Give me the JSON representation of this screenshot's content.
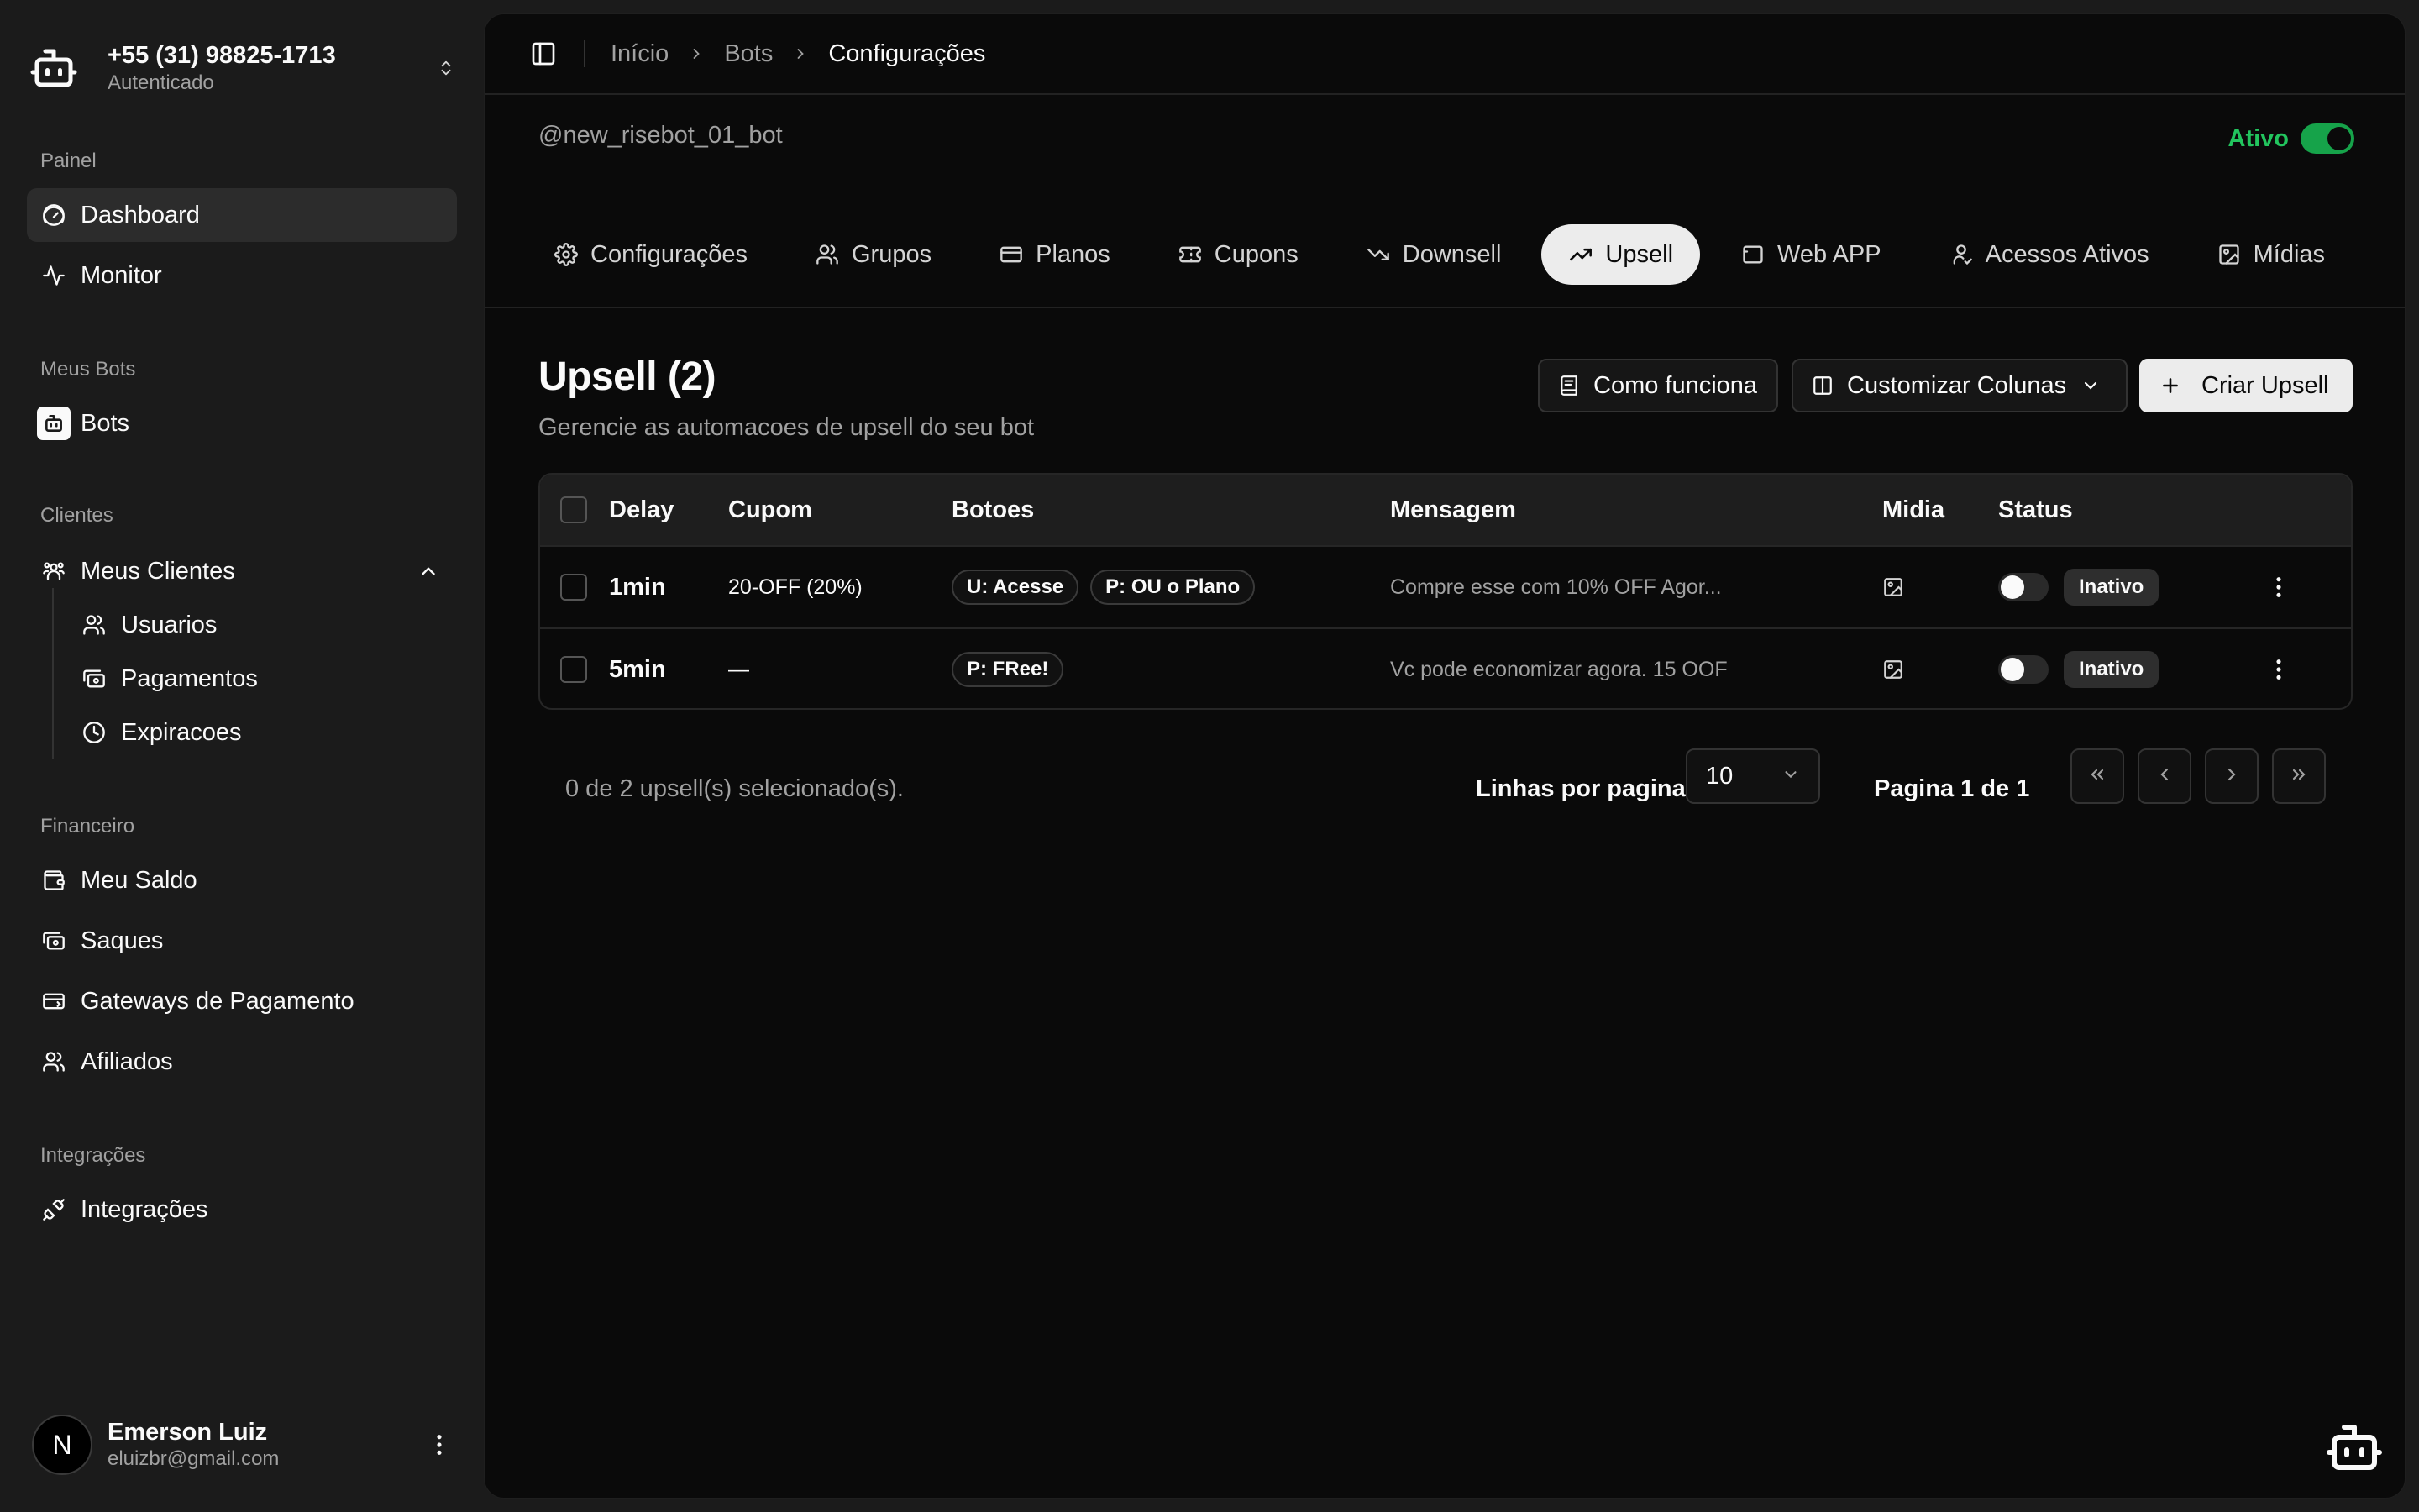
{
  "account": {
    "phone": "+55 (31) 98825-1713",
    "status": "Autenticado"
  },
  "sidebar": {
    "sections": {
      "painel": "Painel",
      "meus_bots": "Meus Bots",
      "clientes": "Clientes",
      "financeiro": "Financeiro",
      "integracoes": "Integrações"
    },
    "items": {
      "dashboard": "Dashboard",
      "monitor": "Monitor",
      "bots": "Bots",
      "meus_clientes": "Meus Clientes",
      "usuarios": "Usuarios",
      "pagamentos": "Pagamentos",
      "expiracoes": "Expiracoes",
      "meu_saldo": "Meu Saldo",
      "saques": "Saques",
      "gateways": "Gateways de Pagamento",
      "afiliados": "Afiliados",
      "integracoes": "Integrações"
    }
  },
  "user": {
    "initial": "N",
    "name": "Emerson Luiz",
    "email": "eluizbr@gmail.com"
  },
  "breadcrumb": [
    "Início",
    "Bots",
    "Configurações"
  ],
  "bot": {
    "handle": "@new_risebot_01_bot",
    "status_label": "Ativo",
    "active": true
  },
  "tabs": [
    {
      "label": "Configurações",
      "icon": "gear-icon"
    },
    {
      "label": "Grupos",
      "icon": "users-icon"
    },
    {
      "label": "Planos",
      "icon": "card-icon"
    },
    {
      "label": "Cupons",
      "icon": "ticket-icon"
    },
    {
      "label": "Downsell",
      "icon": "trend-down-icon"
    },
    {
      "label": "Upsell",
      "icon": "trend-up-icon",
      "active": true
    },
    {
      "label": "Web APP",
      "icon": "window-icon"
    },
    {
      "label": "Acessos Ativos",
      "icon": "user-check-icon"
    },
    {
      "label": "Mídias",
      "icon": "image-icon"
    }
  ],
  "page": {
    "title": "Upsell (2)",
    "subtitle": "Gerencie as automacoes de upsell do seu bot",
    "how_it_works": "Como funciona",
    "customize_columns": "Customizar Colunas",
    "create": "Criar Upsell"
  },
  "table": {
    "headers": {
      "delay": "Delay",
      "cupom": "Cupom",
      "botoes": "Botoes",
      "mensagem": "Mensagem",
      "midia": "Midia",
      "status": "Status"
    },
    "rows": [
      {
        "delay": "1min",
        "cupom": "20-OFF (20%)",
        "botoes": [
          "U: Acesse",
          "P: OU o Plano"
        ],
        "mensagem": "Compre esse com 10% OFF Agor...",
        "status": "Inativo",
        "active": false
      },
      {
        "delay": "5min",
        "cupom": "—",
        "botoes": [
          "P: FRee!"
        ],
        "mensagem": "Vc pode economizar agora. 15 OOF",
        "status": "Inativo",
        "active": false
      }
    ]
  },
  "pagination": {
    "selected": "0 de 2 upsell(s) selecionado(s).",
    "rows_label": "Linhas por pagina",
    "rows_value": "10",
    "page_label": "Pagina 1 de 1"
  },
  "colors": {
    "accent_green": "#22c55e",
    "panel_bg": "#0a0a0a",
    "sidebar_bg": "#1b1b1b"
  }
}
